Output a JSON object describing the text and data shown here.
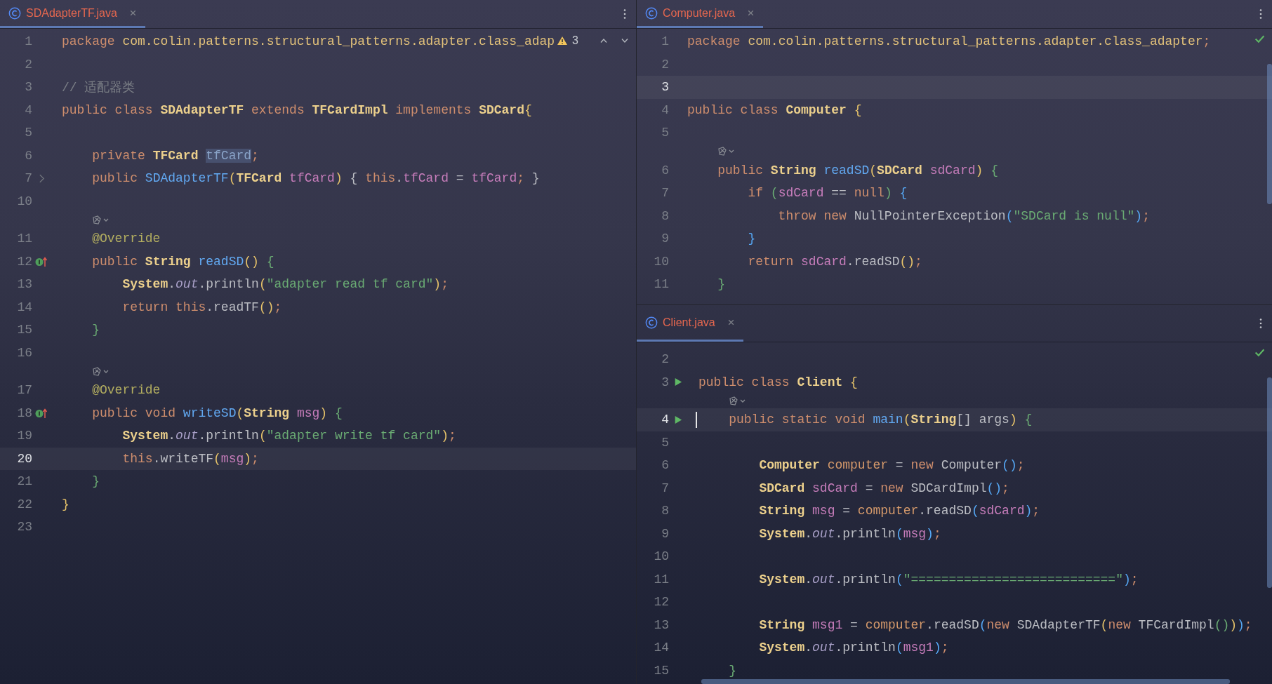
{
  "panes": [
    {
      "tab": {
        "label": "SDAdapterTF.java",
        "selected": true
      },
      "status": {
        "kind": "warning",
        "count": "3"
      },
      "lines": [
        {
          "n": "1",
          "current": false,
          "t": [
            {
              "kind": "kw",
              "text": "package "
            },
            {
              "kind": "pkg",
              "text": "com.colin.patterns.structural_patterns.adapter.class_adap"
            }
          ]
        },
        {
          "n": "2",
          "current": false
        },
        {
          "n": "3",
          "current": false,
          "t": [
            {
              "kind": "cmt",
              "text": "// 适配器类"
            }
          ]
        },
        {
          "n": "4",
          "current": false,
          "t": [
            {
              "kind": "kw",
              "text": "public class "
            },
            {
              "kind": "cls",
              "text": "SDAdapterTF"
            },
            {
              "kind": "kw",
              "text": " extends "
            },
            {
              "kind": "cls",
              "text": "TFCardImpl"
            },
            {
              "kind": "kw",
              "text": " implements "
            },
            {
              "kind": "cls",
              "text": "SDCard"
            },
            {
              "kind": "b1",
              "text": "{"
            }
          ]
        },
        {
          "n": "5",
          "current": false
        },
        {
          "n": "6",
          "current": false,
          "t": [
            {
              "kind": "kw",
              "text": "    private "
            },
            {
              "kind": "cls",
              "text": "TFCard "
            },
            {
              "kind": "varsel",
              "text": "tfCard"
            },
            {
              "kind": "kw",
              "text": ";"
            }
          ]
        },
        {
          "n": "7",
          "current": false,
          "gutter": {
            "kind": "fold"
          },
          "t": [
            {
              "kind": "kw",
              "text": "    public "
            },
            {
              "kind": "fn",
              "text": "SDAdapterTF"
            },
            {
              "kind": "b1",
              "text": "("
            },
            {
              "kind": "cls",
              "text": "TFCard "
            },
            {
              "kind": "var",
              "text": "tfCard"
            },
            {
              "kind": "b1",
              "text": ")"
            },
            {
              "kind": "txt",
              "text": " { "
            },
            {
              "kind": "kw",
              "text": "this"
            },
            {
              "kind": "txt",
              "text": "."
            },
            {
              "kind": "var",
              "text": "tfCard"
            },
            {
              "kind": "txt",
              "text": " = "
            },
            {
              "kind": "var",
              "text": "tfCard"
            },
            {
              "kind": "kw",
              "text": ";"
            },
            {
              "kind": "txt",
              "text": " }"
            }
          ]
        },
        {
          "n": "10",
          "current": false
        },
        {
          "n": "11",
          "current": false,
          "hint": true,
          "t": [
            {
              "kind": "ann",
              "text": "    @Override"
            }
          ]
        },
        {
          "n": "12",
          "current": false,
          "gutter": {
            "kind": "override"
          },
          "t": [
            {
              "kind": "kw",
              "text": "    public "
            },
            {
              "kind": "cls",
              "text": "String "
            },
            {
              "kind": "fn",
              "text": "readSD"
            },
            {
              "kind": "b1",
              "text": "() "
            },
            {
              "kind": "b2",
              "text": "{"
            }
          ]
        },
        {
          "n": "13",
          "current": false,
          "t": [
            {
              "kind": "cls",
              "text": "        System"
            },
            {
              "kind": "txt",
              "text": "."
            },
            {
              "kind": "sta",
              "text": "out"
            },
            {
              "kind": "txt",
              "text": ".println"
            },
            {
              "kind": "b1",
              "text": "("
            },
            {
              "kind": "str",
              "text": "\"adapter read tf card\""
            },
            {
              "kind": "b1",
              "text": ")"
            },
            {
              "kind": "kw",
              "text": ";"
            }
          ]
        },
        {
          "n": "14",
          "current": false,
          "t": [
            {
              "kind": "kw",
              "text": "        return this"
            },
            {
              "kind": "txt",
              "text": ".readTF"
            },
            {
              "kind": "b1",
              "text": "()"
            },
            {
              "kind": "kw",
              "text": ";"
            }
          ]
        },
        {
          "n": "15",
          "current": false,
          "t": [
            {
              "kind": "b2",
              "text": "    }"
            }
          ]
        },
        {
          "n": "16",
          "current": false
        },
        {
          "n": "17",
          "current": false,
          "hint": true,
          "t": [
            {
              "kind": "ann",
              "text": "    @Override"
            }
          ]
        },
        {
          "n": "18",
          "current": false,
          "gutter": {
            "kind": "override"
          },
          "t": [
            {
              "kind": "kw",
              "text": "    public void "
            },
            {
              "kind": "fn",
              "text": "writeSD"
            },
            {
              "kind": "b1",
              "text": "("
            },
            {
              "kind": "cls",
              "text": "String "
            },
            {
              "kind": "var",
              "text": "msg"
            },
            {
              "kind": "b1",
              "text": ") "
            },
            {
              "kind": "b2",
              "text": "{"
            }
          ]
        },
        {
          "n": "19",
          "current": false,
          "t": [
            {
              "kind": "cls",
              "text": "        System"
            },
            {
              "kind": "txt",
              "text": "."
            },
            {
              "kind": "sta",
              "text": "out"
            },
            {
              "kind": "txt",
              "text": ".println"
            },
            {
              "kind": "b1",
              "text": "("
            },
            {
              "kind": "str",
              "text": "\"adapter write tf card\""
            },
            {
              "kind": "b1",
              "text": ")"
            },
            {
              "kind": "kw",
              "text": ";"
            }
          ]
        },
        {
          "n": "20",
          "current": true,
          "t": [
            {
              "kind": "kw",
              "text": "        this"
            },
            {
              "kind": "txt",
              "text": ".writeTF"
            },
            {
              "kind": "b1",
              "text": "("
            },
            {
              "kind": "var",
              "text": "msg"
            },
            {
              "kind": "b1",
              "text": ")"
            },
            {
              "kind": "kw",
              "text": ";"
            }
          ]
        },
        {
          "n": "21",
          "current": false,
          "t": [
            {
              "kind": "b2",
              "text": "    }"
            }
          ]
        },
        {
          "n": "22",
          "current": false,
          "t": [
            {
              "kind": "b1",
              "text": "}"
            }
          ]
        },
        {
          "n": "23",
          "current": false
        }
      ]
    },
    {
      "tab": {
        "label": "Computer.java",
        "selected": true
      },
      "status": {
        "kind": "ok"
      },
      "lines": [
        {
          "n": "1",
          "current": false,
          "t": [
            {
              "kind": "kw",
              "text": "package "
            },
            {
              "kind": "pkg",
              "text": "com.colin.patterns.structural_patterns.adapter.class_adapter"
            },
            {
              "kind": "kw",
              "text": ";"
            }
          ]
        },
        {
          "n": "2",
          "current": false
        },
        {
          "n": "3",
          "current": true
        },
        {
          "n": "4",
          "current": false,
          "t": [
            {
              "kind": "kw",
              "text": "public class "
            },
            {
              "kind": "cls",
              "text": "Computer "
            },
            {
              "kind": "b1",
              "text": "{"
            }
          ]
        },
        {
          "n": "5",
          "current": false
        },
        {
          "n": "6",
          "current": false,
          "hint": true,
          "t": [
            {
              "kind": "kw",
              "text": "    public "
            },
            {
              "kind": "cls",
              "text": "String "
            },
            {
              "kind": "fn",
              "text": "readSD"
            },
            {
              "kind": "b1",
              "text": "("
            },
            {
              "kind": "cls",
              "text": "SDCard "
            },
            {
              "kind": "var",
              "text": "sdCard"
            },
            {
              "kind": "b1",
              "text": ") "
            },
            {
              "kind": "b2",
              "text": "{"
            }
          ]
        },
        {
          "n": "7",
          "current": false,
          "t": [
            {
              "kind": "kw",
              "text": "        if "
            },
            {
              "kind": "b2",
              "text": "("
            },
            {
              "kind": "var",
              "text": "sdCard"
            },
            {
              "kind": "txt",
              "text": " == "
            },
            {
              "kind": "kw",
              "text": "null"
            },
            {
              "kind": "b2",
              "text": ") "
            },
            {
              "kind": "b3",
              "text": "{"
            }
          ]
        },
        {
          "n": "8",
          "current": false,
          "t": [
            {
              "kind": "kw",
              "text": "            throw new "
            },
            {
              "kind": "txt",
              "text": "NullPointerException"
            },
            {
              "kind": "b3",
              "text": "("
            },
            {
              "kind": "str",
              "text": "\"SDCard is null\""
            },
            {
              "kind": "b3",
              "text": ")"
            },
            {
              "kind": "kw",
              "text": ";"
            }
          ]
        },
        {
          "n": "9",
          "current": false,
          "t": [
            {
              "kind": "b3",
              "text": "        }"
            }
          ]
        },
        {
          "n": "10",
          "current": false,
          "t": [
            {
              "kind": "kw",
              "text": "        return "
            },
            {
              "kind": "var",
              "text": "sdCard"
            },
            {
              "kind": "txt",
              "text": ".readSD"
            },
            {
              "kind": "b1",
              "text": "()"
            },
            {
              "kind": "kw",
              "text": ";"
            }
          ]
        },
        {
          "n": "11",
          "current": false,
          "t": [
            {
              "kind": "b2",
              "text": "    }"
            }
          ]
        }
      ]
    },
    {
      "tab": {
        "label": "Client.java",
        "selected": true
      },
      "status": {
        "kind": "ok"
      },
      "lines": [
        {
          "n": "2",
          "current": false
        },
        {
          "n": "3",
          "current": false,
          "gutter": {
            "kind": "run"
          },
          "t": [
            {
              "kind": "kw",
              "text": "public class "
            },
            {
              "kind": "cls",
              "text": "Client "
            },
            {
              "kind": "b1",
              "text": "{"
            }
          ]
        },
        {
          "n": "4",
          "current": true,
          "hint": true,
          "caret": true,
          "gutter": {
            "kind": "run"
          },
          "t": [
            {
              "kind": "kw",
              "text": "    public static void "
            },
            {
              "kind": "fn",
              "text": "main"
            },
            {
              "kind": "b1",
              "text": "("
            },
            {
              "kind": "cls",
              "text": "String"
            },
            {
              "kind": "txt",
              "text": "[] args"
            },
            {
              "kind": "b1",
              "text": ") "
            },
            {
              "kind": "b2",
              "text": "{"
            }
          ]
        },
        {
          "n": "5",
          "current": false
        },
        {
          "n": "6",
          "current": false,
          "t": [
            {
              "kind": "cls",
              "text": "        Computer "
            },
            {
              "kind": "loc",
              "text": "computer"
            },
            {
              "kind": "txt",
              "text": " = "
            },
            {
              "kind": "kw",
              "text": "new "
            },
            {
              "kind": "txt",
              "text": "Computer"
            },
            {
              "kind": "b3",
              "text": "()"
            },
            {
              "kind": "kw",
              "text": ";"
            }
          ]
        },
        {
          "n": "7",
          "current": false,
          "t": [
            {
              "kind": "cls",
              "text": "        SDCard "
            },
            {
              "kind": "var",
              "text": "sdCard"
            },
            {
              "kind": "txt",
              "text": " = "
            },
            {
              "kind": "kw",
              "text": "new "
            },
            {
              "kind": "txt",
              "text": "SDCardImpl"
            },
            {
              "kind": "b3",
              "text": "()"
            },
            {
              "kind": "kw",
              "text": ";"
            }
          ]
        },
        {
          "n": "8",
          "current": false,
          "t": [
            {
              "kind": "cls",
              "text": "        String "
            },
            {
              "kind": "var",
              "text": "msg"
            },
            {
              "kind": "txt",
              "text": " = "
            },
            {
              "kind": "loc",
              "text": "computer"
            },
            {
              "kind": "txt",
              "text": ".readSD"
            },
            {
              "kind": "b3",
              "text": "("
            },
            {
              "kind": "var",
              "text": "sdCard"
            },
            {
              "kind": "b3",
              "text": ")"
            },
            {
              "kind": "kw",
              "text": ";"
            }
          ]
        },
        {
          "n": "9",
          "current": false,
          "t": [
            {
              "kind": "cls",
              "text": "        System"
            },
            {
              "kind": "txt",
              "text": "."
            },
            {
              "kind": "sta",
              "text": "out"
            },
            {
              "kind": "txt",
              "text": ".println"
            },
            {
              "kind": "b3",
              "text": "("
            },
            {
              "kind": "var",
              "text": "msg"
            },
            {
              "kind": "b3",
              "text": ")"
            },
            {
              "kind": "kw",
              "text": ";"
            }
          ]
        },
        {
          "n": "10",
          "current": false
        },
        {
          "n": "11",
          "current": false,
          "t": [
            {
              "kind": "cls",
              "text": "        System"
            },
            {
              "kind": "txt",
              "text": "."
            },
            {
              "kind": "sta",
              "text": "out"
            },
            {
              "kind": "txt",
              "text": ".println"
            },
            {
              "kind": "b3",
              "text": "("
            },
            {
              "kind": "str",
              "text": "\"===========================\""
            },
            {
              "kind": "b3",
              "text": ")"
            },
            {
              "kind": "kw",
              "text": ";"
            }
          ]
        },
        {
          "n": "12",
          "current": false
        },
        {
          "n": "13",
          "current": false,
          "t": [
            {
              "kind": "cls",
              "text": "        String "
            },
            {
              "kind": "var",
              "text": "msg1"
            },
            {
              "kind": "txt",
              "text": " = "
            },
            {
              "kind": "loc",
              "text": "computer"
            },
            {
              "kind": "txt",
              "text": ".readSD"
            },
            {
              "kind": "b3",
              "text": "("
            },
            {
              "kind": "kw",
              "text": "new "
            },
            {
              "kind": "txt",
              "text": "SDAdapterTF"
            },
            {
              "kind": "b1",
              "text": "("
            },
            {
              "kind": "kw",
              "text": "new "
            },
            {
              "kind": "txt",
              "text": "TFCardImpl"
            },
            {
              "kind": "b2",
              "text": "()"
            },
            {
              "kind": "b1",
              "text": ")"
            },
            {
              "kind": "b3",
              "text": ")"
            },
            {
              "kind": "kw",
              "text": ";"
            }
          ]
        },
        {
          "n": "14",
          "current": false,
          "t": [
            {
              "kind": "cls",
              "text": "        System"
            },
            {
              "kind": "txt",
              "text": "."
            },
            {
              "kind": "sta",
              "text": "out"
            },
            {
              "kind": "txt",
              "text": ".println"
            },
            {
              "kind": "b3",
              "text": "("
            },
            {
              "kind": "var",
              "text": "msg1"
            },
            {
              "kind": "b3",
              "text": ")"
            },
            {
              "kind": "kw",
              "text": ";"
            }
          ]
        },
        {
          "n": "15",
          "current": false,
          "t": [
            {
              "kind": "b2",
              "text": "    }"
            }
          ]
        }
      ]
    }
  ]
}
